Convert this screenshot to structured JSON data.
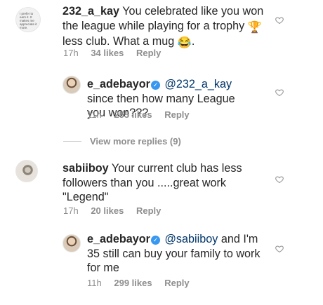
{
  "comments": [
    {
      "username": "232_a_kay",
      "avatar_text": "I prefer to earn it. It makes me appreciate it more.",
      "text_part1": "You celebrated like you won the league while playing for a trophy",
      "text_part2": "less club. What a mug",
      "emoji_trophy": "🏆",
      "emoji_laugh": "😂",
      "end_punct": ".",
      "time": "17h",
      "likes": "34 likes",
      "reply": "Reply"
    },
    {
      "username": "e_adebayor",
      "mention": "@232_a_kay",
      "text": "since then how many League you won???",
      "time": "11h",
      "likes": "255 likes",
      "reply": "Reply"
    },
    {
      "username": "sabiiboy",
      "text": "Your current club has less followers than you .....great work \"Legend\"",
      "time": "17h",
      "likes": "20 likes",
      "reply": "Reply"
    },
    {
      "username": "e_adebayor",
      "mention": "@sabiiboy",
      "text": "and I'm 35 still can buy your family to work for me",
      "time": "11h",
      "likes": "299 likes",
      "reply": "Reply"
    }
  ],
  "view_more": "View more replies (9)",
  "icons": {
    "heart": "heart-outline-icon",
    "verified": "verified-badge-icon"
  },
  "colors": {
    "text": "#262626",
    "meta": "#8e8e8e",
    "mention": "#003569",
    "verified": "#3897f0"
  }
}
